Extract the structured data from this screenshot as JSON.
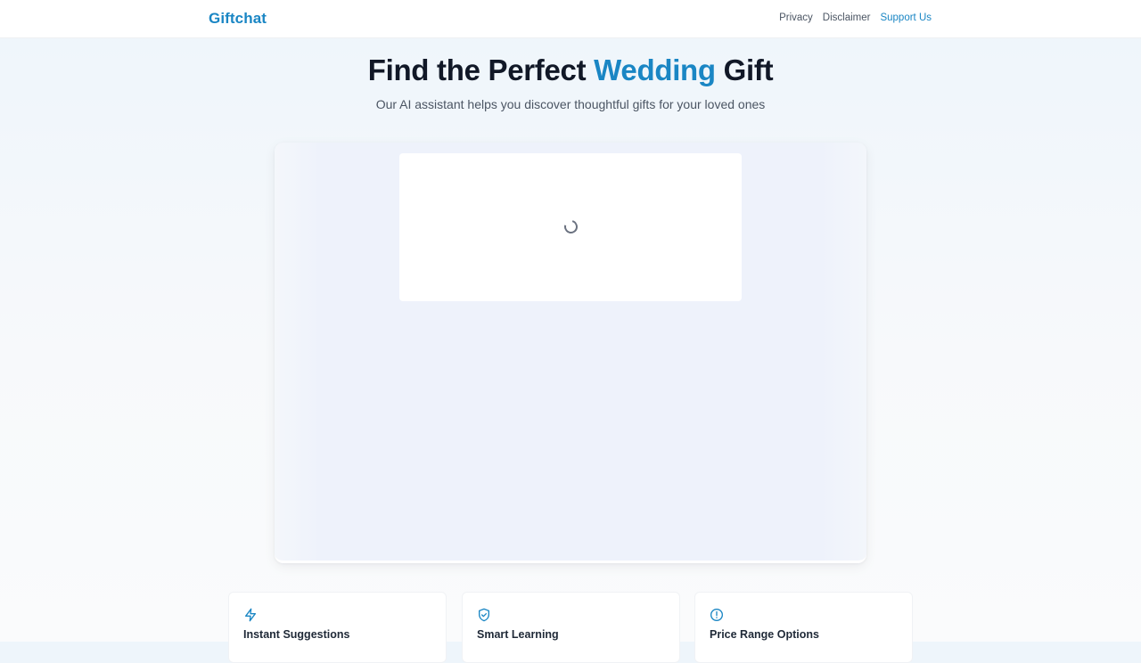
{
  "nav": {
    "brand": "Giftchat",
    "links": [
      {
        "label": "Privacy"
      },
      {
        "label": "Disclaimer"
      },
      {
        "label": "Support Us"
      }
    ]
  },
  "hero": {
    "title_prefix": "Find the Perfect ",
    "title_accent": "Wedding",
    "title_suffix": " Gift",
    "subtitle": "Our AI assistant helps you discover thoughtful gifts for your loved ones"
  },
  "chat": {
    "state": "loading"
  },
  "features": [
    {
      "title": "Instant Suggestions",
      "icon": "lightning-icon"
    },
    {
      "title": "Smart Learning",
      "icon": "shield-check-icon"
    },
    {
      "title": "Price Range Options",
      "icon": "info-circle-icon"
    }
  ],
  "colors": {
    "accent": "#1a86c4",
    "heading": "#111827",
    "text": "#4b5563"
  }
}
